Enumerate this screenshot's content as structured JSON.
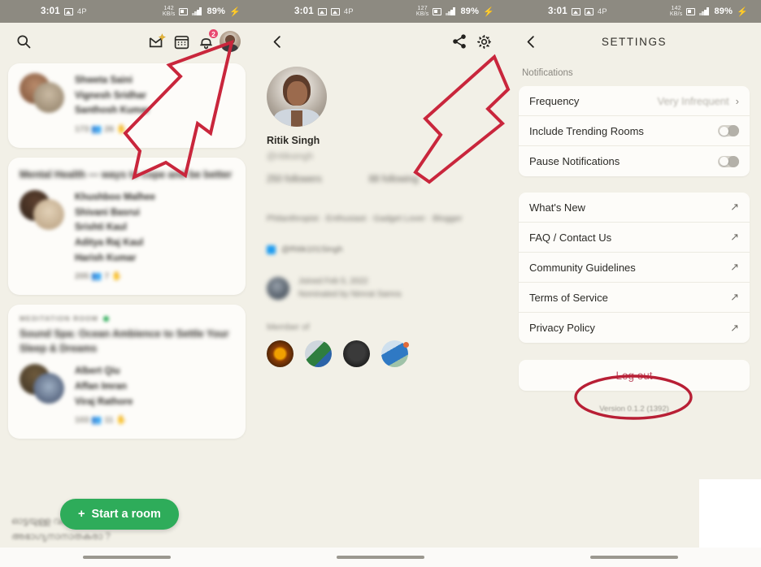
{
  "colors": {
    "app_background": "#f2f0e7",
    "card": "#fdfcf9",
    "accent_green": "#2eac5a",
    "logout_red": "#c0566a",
    "annotation_red": "#c9263c",
    "statusbar": "#8d8a81",
    "badge": "#e8486f"
  },
  "status_bar": {
    "time": "3:01",
    "network_speed": "142",
    "network_speed_unit": "KB/s",
    "battery": "89%",
    "charging_glyph": "⚡",
    "icons": [
      "image-icon",
      "screenshot-icon",
      "4p-icon",
      "speed-icon",
      "hd-icon",
      "signal-icon",
      "battery-icon"
    ],
    "sim_label": "4P"
  },
  "panel_home": {
    "header": {
      "search_icon": "search-icon",
      "invite_icon": "invite-envelope-icon",
      "calendar_icon": "calendar-icon",
      "bell_icon": "bell-icon",
      "bell_badge": "2",
      "avatar_icon": "avatar"
    },
    "cards": [
      {
        "tag": "",
        "live": false,
        "title": "",
        "names": [
          "Shweta Saini",
          "Vignesh Sridhar",
          "Santhosh Kumar"
        ],
        "meta": "173 👥   26 ✋"
      },
      {
        "tag": "",
        "live": false,
        "title": "Mental Health — ways to cope and be better",
        "names": [
          "Khushboo Malhee",
          "Shivani Basrui",
          "Srishti Kaul",
          "Aditya Raj Kaul",
          "Harish Kumar"
        ],
        "meta": "205 👥   7 ✋"
      },
      {
        "tag": "MEDITATION ROOM",
        "live": true,
        "title": "Sound Spa: Ocean Ambience to Settle Your Sleep & Dreams",
        "names": [
          "Albert Qiu",
          "Affan Imran",
          "Viraj Rathore"
        ],
        "meta": "103 👥   11 ✋"
      }
    ],
    "fab": {
      "label": "Start a room",
      "plus": "+"
    },
    "footer_text_line1": "ഓട്ടയുള്ള വഞ്ചിയിലെ",
    "footer_text_line2": "അഭാഗ്യനാനാതകരാ ?"
  },
  "panel_profile": {
    "back_icon": "chevron-left-icon",
    "share_icon": "share-icon",
    "settings_icon": "gear-icon",
    "name": "Ritik Singh",
    "handle": "@ritiksingh",
    "followers": "250 followers",
    "following": "88 following",
    "bio": "Philanthropist · Enthusiast · Gadget Lover · Blogger",
    "twitter_handle": "@Ritik101Singh",
    "joined": "Joined Feb 5, 2022",
    "nominated_by": "Nominated by Nimrat Samra",
    "member_of_label": "Member of",
    "rooms": [
      "room-icon-1",
      "room-icon-2",
      "room-icon-3",
      "room-icon-4"
    ]
  },
  "panel_settings": {
    "back_icon": "chevron-left-icon",
    "title": "SETTINGS",
    "section_notifications_label": "Notifications",
    "notification_rows": [
      {
        "label": "Frequency",
        "value": "Very Infrequent",
        "control": "chevron",
        "chevron": "›"
      },
      {
        "label": "Include Trending Rooms",
        "value": "",
        "control": "toggle",
        "toggle_on": false
      },
      {
        "label": "Pause Notifications",
        "value": "",
        "control": "toggle",
        "toggle_on": false
      }
    ],
    "link_rows": [
      {
        "label": "What's New",
        "control": "external",
        "glyph": "↗"
      },
      {
        "label": "FAQ / Contact Us",
        "control": "external",
        "glyph": "↗"
      },
      {
        "label": "Community Guidelines",
        "control": "external",
        "glyph": "↗"
      },
      {
        "label": "Terms of Service",
        "control": "external",
        "glyph": "↗"
      },
      {
        "label": "Privacy Policy",
        "control": "external",
        "glyph": "↗"
      }
    ],
    "logout_label": "Log out",
    "version": "Version 0.1.2 (1392)"
  },
  "annotations": {
    "arrow_to_avatar": "red-arrow-pointing-to-profile-avatar",
    "arrow_to_gear": "red-arrow-pointing-to-settings-gear",
    "ellipse_logout": "red-ellipse-highlighting-log-out"
  }
}
